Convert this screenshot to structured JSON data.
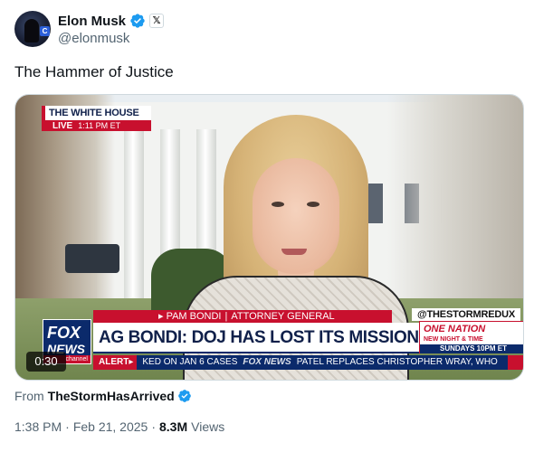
{
  "author": {
    "name": "Elon Musk",
    "handle": "@elonmusk",
    "affiliate_badge": "𝕏"
  },
  "tweet": {
    "text": "The Hammer of Justice"
  },
  "media": {
    "duration": "0:30",
    "broadcast": {
      "location_bug": "THE WHITE HOUSE",
      "live_label": "LIVE",
      "time": "1:11 PM ET",
      "name_label": "PAM BONDI",
      "title_label": "ATTORNEY GENERAL",
      "headline": "AG BONDI: DOJ HAS LOST ITS MISSION TO FIGHT CRIME",
      "alert_label": "ALERT▸",
      "ticker_left": "KED ON JAN 6 CASES",
      "ticker_brand": "FOX NEWS",
      "ticker_right": "PATEL REPLACES CHRISTOPHER WRAY, WHO",
      "network_logo_line1": "FOX",
      "network_logo_line2": "NEWS",
      "network_logo_sub": "channel",
      "watermark": "@THESTORMREDUX",
      "promo_show": "ONE NATION",
      "promo_line": "NEW NIGHT & TIME",
      "promo_time": "SUNDAYS 10PM ET"
    }
  },
  "source": {
    "from_label": "From",
    "name": "TheStormHasArrived"
  },
  "meta": {
    "time": "1:38 PM",
    "date": "Feb 21, 2025",
    "views_count": "8.3M",
    "views_label": "Views"
  },
  "colors": {
    "verified_blue": "#1d9bf0",
    "fox_red": "#c8102e",
    "fox_navy": "#0b2a6b"
  }
}
